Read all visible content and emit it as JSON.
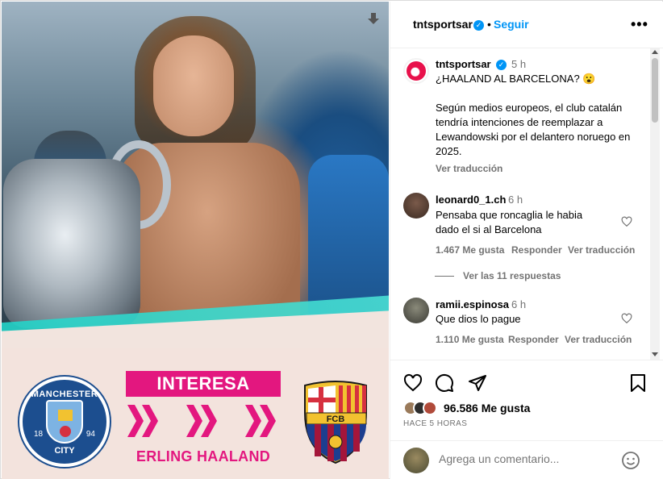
{
  "header": {
    "username": "tntsportsar",
    "separator": "•",
    "follow_label": "Seguir",
    "more": "•••"
  },
  "caption": {
    "username": "tntsportsar",
    "time": "5 h",
    "title": "¿HAALAND AL BARCELONA? 😮",
    "body": "Según medios europeos, el club catalán tendría intenciones de reemplazar a Lewandowski por el delantero noruego en 2025.",
    "translate": "Ver traducción"
  },
  "comments": [
    {
      "username": "leonard0_1.ch",
      "time": "6 h",
      "text": "Pensaba que roncaglia le habia dado el si al Barcelona",
      "likes": "1.467 Me gusta",
      "reply": "Responder",
      "translate": "Ver traducción"
    },
    {
      "username": "ramii.espinosa",
      "time": "6 h",
      "text": "Que dios lo pague",
      "likes": "1.110 Me gusta",
      "reply": "Responder",
      "translate": "Ver traducción"
    }
  ],
  "view_replies": "Ver las 11 respuestas",
  "post": {
    "likes_count": "96.586",
    "likes_label": "Me gusta",
    "timestamp": "HACE 5 HORAS"
  },
  "composer": {
    "placeholder": "Agrega un comentario..."
  },
  "graphic": {
    "banner": "INTERESA",
    "player": "ERLING HAALAND",
    "city_top": "MANCHESTER",
    "city_bottom": "CITY",
    "city_year_left": "18",
    "city_year_right": "94",
    "fcb": "FCB"
  },
  "colors": {
    "accent_blue": "#0095f6",
    "magenta": "#e3177f",
    "secondary_text": "#737373"
  }
}
